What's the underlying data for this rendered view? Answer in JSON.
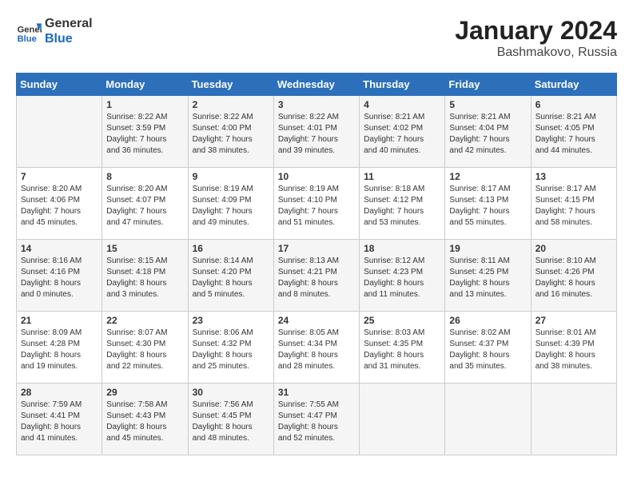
{
  "header": {
    "logo_line1": "General",
    "logo_line2": "Blue",
    "month_title": "January 2024",
    "location": "Bashmakovo, Russia"
  },
  "days_of_week": [
    "Sunday",
    "Monday",
    "Tuesday",
    "Wednesday",
    "Thursday",
    "Friday",
    "Saturday"
  ],
  "weeks": [
    [
      {
        "day": "",
        "info": ""
      },
      {
        "day": "1",
        "info": "Sunrise: 8:22 AM\nSunset: 3:59 PM\nDaylight: 7 hours\nand 36 minutes."
      },
      {
        "day": "2",
        "info": "Sunrise: 8:22 AM\nSunset: 4:00 PM\nDaylight: 7 hours\nand 38 minutes."
      },
      {
        "day": "3",
        "info": "Sunrise: 8:22 AM\nSunset: 4:01 PM\nDaylight: 7 hours\nand 39 minutes."
      },
      {
        "day": "4",
        "info": "Sunrise: 8:21 AM\nSunset: 4:02 PM\nDaylight: 7 hours\nand 40 minutes."
      },
      {
        "day": "5",
        "info": "Sunrise: 8:21 AM\nSunset: 4:04 PM\nDaylight: 7 hours\nand 42 minutes."
      },
      {
        "day": "6",
        "info": "Sunrise: 8:21 AM\nSunset: 4:05 PM\nDaylight: 7 hours\nand 44 minutes."
      }
    ],
    [
      {
        "day": "7",
        "info": "Sunrise: 8:20 AM\nSunset: 4:06 PM\nDaylight: 7 hours\nand 45 minutes."
      },
      {
        "day": "8",
        "info": "Sunrise: 8:20 AM\nSunset: 4:07 PM\nDaylight: 7 hours\nand 47 minutes."
      },
      {
        "day": "9",
        "info": "Sunrise: 8:19 AM\nSunset: 4:09 PM\nDaylight: 7 hours\nand 49 minutes."
      },
      {
        "day": "10",
        "info": "Sunrise: 8:19 AM\nSunset: 4:10 PM\nDaylight: 7 hours\nand 51 minutes."
      },
      {
        "day": "11",
        "info": "Sunrise: 8:18 AM\nSunset: 4:12 PM\nDaylight: 7 hours\nand 53 minutes."
      },
      {
        "day": "12",
        "info": "Sunrise: 8:17 AM\nSunset: 4:13 PM\nDaylight: 7 hours\nand 55 minutes."
      },
      {
        "day": "13",
        "info": "Sunrise: 8:17 AM\nSunset: 4:15 PM\nDaylight: 7 hours\nand 58 minutes."
      }
    ],
    [
      {
        "day": "14",
        "info": "Sunrise: 8:16 AM\nSunset: 4:16 PM\nDaylight: 8 hours\nand 0 minutes."
      },
      {
        "day": "15",
        "info": "Sunrise: 8:15 AM\nSunset: 4:18 PM\nDaylight: 8 hours\nand 3 minutes."
      },
      {
        "day": "16",
        "info": "Sunrise: 8:14 AM\nSunset: 4:20 PM\nDaylight: 8 hours\nand 5 minutes."
      },
      {
        "day": "17",
        "info": "Sunrise: 8:13 AM\nSunset: 4:21 PM\nDaylight: 8 hours\nand 8 minutes."
      },
      {
        "day": "18",
        "info": "Sunrise: 8:12 AM\nSunset: 4:23 PM\nDaylight: 8 hours\nand 11 minutes."
      },
      {
        "day": "19",
        "info": "Sunrise: 8:11 AM\nSunset: 4:25 PM\nDaylight: 8 hours\nand 13 minutes."
      },
      {
        "day": "20",
        "info": "Sunrise: 8:10 AM\nSunset: 4:26 PM\nDaylight: 8 hours\nand 16 minutes."
      }
    ],
    [
      {
        "day": "21",
        "info": "Sunrise: 8:09 AM\nSunset: 4:28 PM\nDaylight: 8 hours\nand 19 minutes."
      },
      {
        "day": "22",
        "info": "Sunrise: 8:07 AM\nSunset: 4:30 PM\nDaylight: 8 hours\nand 22 minutes."
      },
      {
        "day": "23",
        "info": "Sunrise: 8:06 AM\nSunset: 4:32 PM\nDaylight: 8 hours\nand 25 minutes."
      },
      {
        "day": "24",
        "info": "Sunrise: 8:05 AM\nSunset: 4:34 PM\nDaylight: 8 hours\nand 28 minutes."
      },
      {
        "day": "25",
        "info": "Sunrise: 8:03 AM\nSunset: 4:35 PM\nDaylight: 8 hours\nand 31 minutes."
      },
      {
        "day": "26",
        "info": "Sunrise: 8:02 AM\nSunset: 4:37 PM\nDaylight: 8 hours\nand 35 minutes."
      },
      {
        "day": "27",
        "info": "Sunrise: 8:01 AM\nSunset: 4:39 PM\nDaylight: 8 hours\nand 38 minutes."
      }
    ],
    [
      {
        "day": "28",
        "info": "Sunrise: 7:59 AM\nSunset: 4:41 PM\nDaylight: 8 hours\nand 41 minutes."
      },
      {
        "day": "29",
        "info": "Sunrise: 7:58 AM\nSunset: 4:43 PM\nDaylight: 8 hours\nand 45 minutes."
      },
      {
        "day": "30",
        "info": "Sunrise: 7:56 AM\nSunset: 4:45 PM\nDaylight: 8 hours\nand 48 minutes."
      },
      {
        "day": "31",
        "info": "Sunrise: 7:55 AM\nSunset: 4:47 PM\nDaylight: 8 hours\nand 52 minutes."
      },
      {
        "day": "",
        "info": ""
      },
      {
        "day": "",
        "info": ""
      },
      {
        "day": "",
        "info": ""
      }
    ]
  ]
}
